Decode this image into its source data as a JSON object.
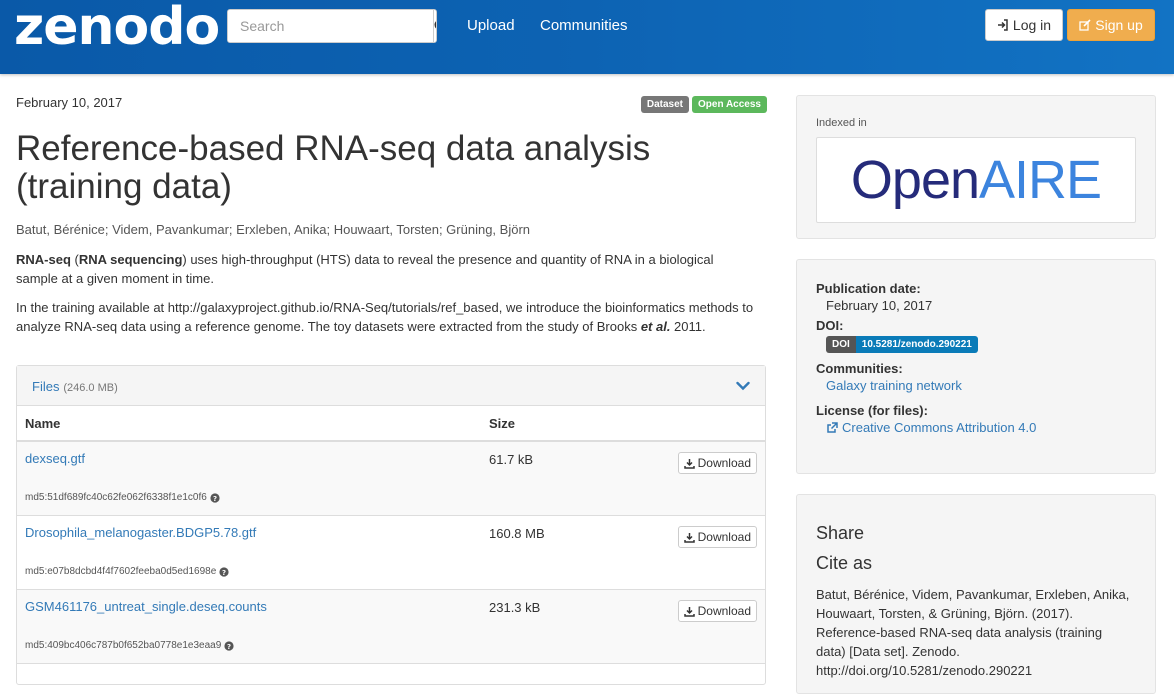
{
  "header": {
    "logo": "zenodo",
    "search_placeholder": "Search",
    "nav": [
      "Upload",
      "Communities"
    ],
    "login_label": "Log in",
    "signup_label": "Sign up"
  },
  "record": {
    "date": "February 10, 2017",
    "badges": [
      "Dataset",
      "Open Access"
    ],
    "title": "Reference-based RNA-seq data analysis (training data)",
    "authors": "Batut, Bérénice; Videm, Pavankumar; Erxleben, Anika; Houwaart, Torsten; Grüning, Björn",
    "desc1_bold1": "RNA-seq",
    "desc1_mid": " (",
    "desc1_bold2": "RNA sequencing",
    "desc1_rest": ") uses high-throughput (HTS) data to reveal the presence and quantity of RNA in a biological sample at a given moment in time.",
    "desc2_text": "In the training available at http://galaxyproject.github.io/RNA-Seq/tutorials/ref_based, we introduce the bioinformatics methods to analyze RNA-seq data using a reference genome. The toy datasets were extracted from the study of Brooks ",
    "desc2_em": "et al.",
    "desc2_tail": " 2011."
  },
  "files": {
    "title": "Files",
    "total_size": "(246.0 MB)",
    "col_name": "Name",
    "col_size": "Size",
    "download_label": "Download",
    "rows": [
      {
        "name": "dexseq.gtf",
        "size": "61.7 kB",
        "md5": "md5:51df689fc40c62fe062f6338f1e1c0f6"
      },
      {
        "name": "Drosophila_melanogaster.BDGP5.78.gtf",
        "size": "160.8 MB",
        "md5": "md5:e07b8dcbd4f4f7602feeba0d5ed1698e"
      },
      {
        "name": "GSM461176_untreat_single.deseq.counts",
        "size": "231.3 kB",
        "md5": "md5:409bc406c787b0f652ba0778e1e3eaa9"
      }
    ]
  },
  "sidebar": {
    "indexed_in": "Indexed in",
    "openaire_open": "Open",
    "openaire_aire": "AIRE",
    "pub_date_label": "Publication date:",
    "pub_date": "February 10, 2017",
    "doi_label": "DOI:",
    "doi_prefix": "DOI",
    "doi_value": "10.5281/zenodo.290221",
    "communities_label": "Communities:",
    "community": "Galaxy training network",
    "license_label": "License (for files):",
    "license": "Creative Commons Attribution 4.0",
    "share_title": "Share",
    "cite_title": "Cite as",
    "citation": "Batut, Bérénice, Videm, Pavankumar, Erxleben, Anika, Houwaart, Torsten, & Grüning, Björn. (2017). Reference-based RNA-seq data analysis (training data) [Data set]. Zenodo. http://doi.org/10.5281/zenodo.290221"
  },
  "colors": {
    "header": "#0d63b3",
    "link": "#337ab7",
    "signup": "#f0ad4e",
    "open_access": "#5cb85c",
    "openaire_dark": "#252b7a",
    "openaire_light": "#3c84de"
  }
}
